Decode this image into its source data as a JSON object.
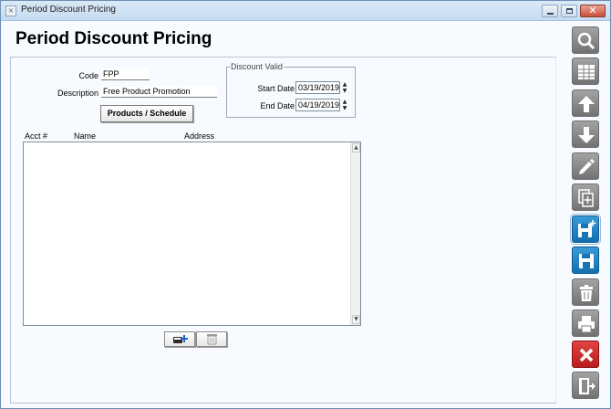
{
  "window": {
    "title": "Period Discount Pricing",
    "icon": "app-icon",
    "controls": [
      "minimize-icon",
      "maximize-icon",
      "close-icon"
    ],
    "close_glyph": "✕"
  },
  "page": {
    "title": "Period Discount Pricing"
  },
  "form": {
    "code_label": "Code",
    "code_value": "FPP",
    "description_label": "Description",
    "description_value": "Free Product Promotion",
    "products_button": "Products / Schedule"
  },
  "discount_valid": {
    "legend": "Discount Valid",
    "start_label": "Start Date",
    "start_value": "03/19/2019",
    "end_label": "End Date",
    "end_value": "04/19/2019"
  },
  "list": {
    "columns": [
      "Acct #",
      "Name",
      "Address"
    ],
    "rows": []
  },
  "list_actions": [
    "add-account-icon",
    "delete-account-icon"
  ],
  "toolbar": [
    {
      "icon": "search-icon",
      "color": "#8a8a8a"
    },
    {
      "icon": "grid-icon",
      "color": "#8a8a8a"
    },
    {
      "icon": "arrow-up-icon",
      "color": "#8a8a8a"
    },
    {
      "icon": "arrow-down-icon",
      "color": "#8a8a8a"
    },
    {
      "icon": "edit-pencil-icon",
      "color": "#8a8a8a"
    },
    {
      "icon": "copy-add-icon",
      "color": "#8a8a8a"
    },
    {
      "icon": "save-new-icon",
      "color": "#1e80c0"
    },
    {
      "icon": "save-icon",
      "color": "#1e80c0"
    },
    {
      "icon": "trash-icon",
      "color": "#8a8a8a"
    },
    {
      "icon": "print-icon",
      "color": "#8a8a8a"
    },
    {
      "icon": "cancel-icon",
      "color": "#d02a2a"
    },
    {
      "icon": "exit-icon",
      "color": "#8a8a8a"
    }
  ]
}
